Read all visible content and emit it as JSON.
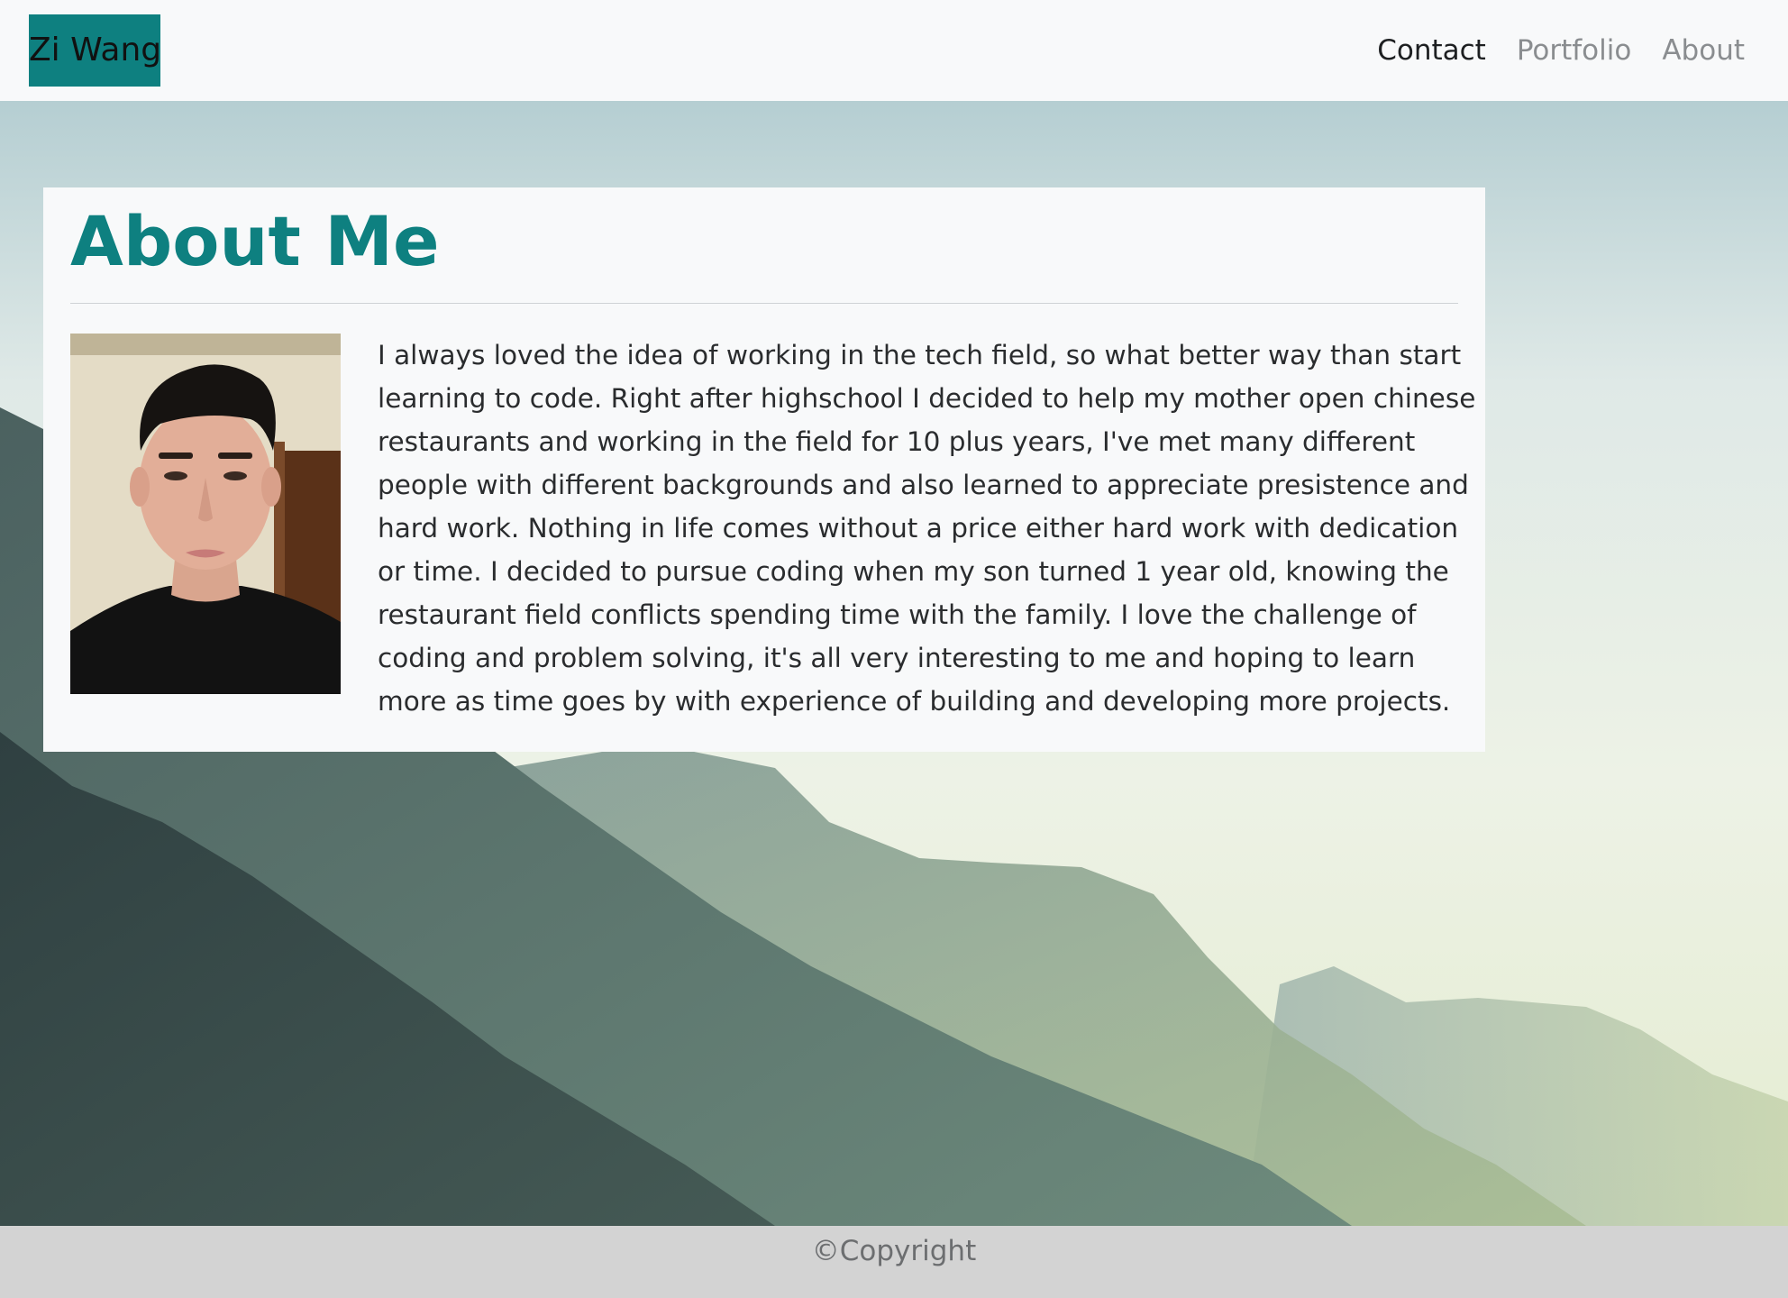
{
  "navbar": {
    "brand": "Zi Wang",
    "links": [
      {
        "label": "Contact",
        "active": true
      },
      {
        "label": "Portfolio",
        "active": false
      },
      {
        "label": "About",
        "active": false
      }
    ]
  },
  "about": {
    "title": "About Me",
    "bio": "I always loved the idea of working in the tech field, so what better way than start learning to code. Right after highschool I decided to help my mother open chinese restaurants and working in the field for 10 plus years, I've met many different people with different backgrounds and also learned to appreciate presistence and hard work. Nothing in life comes without a price either hard work with dedication or time. I decided to pursue coding when my son turned 1 year old, knowing the restaurant field conflicts spending time with the family. I love the challenge of coding and problem solving, it's all very interesting to me and hoping to learn more as time goes by with experience of building and developing more projects."
  },
  "footer": {
    "text": "©Copyright"
  },
  "colors": {
    "accent": "#0e8080",
    "navbar_bg": "#f8f9fa",
    "footer_bg": "#d3d3d3"
  }
}
